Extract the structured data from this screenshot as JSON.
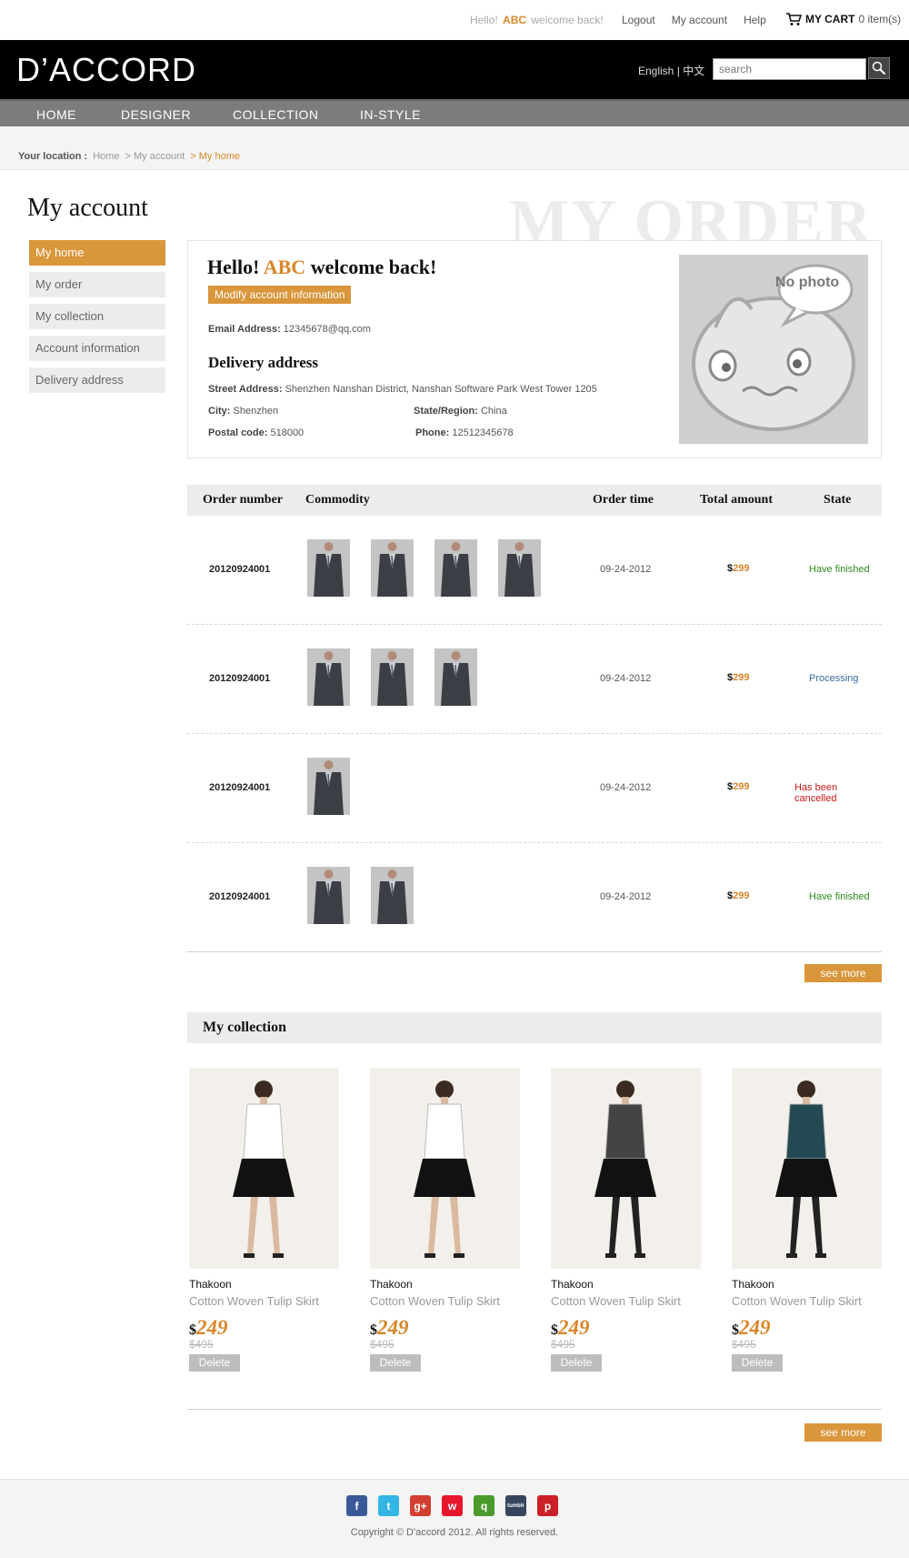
{
  "topbar": {
    "hello": "Hello!",
    "user": "ABC",
    "welcome": "welcome back!",
    "links": [
      "Logout",
      "My account",
      "Help"
    ],
    "cart_label": "MY CART",
    "cart_count": "0 item(s)"
  },
  "header": {
    "logo": "D’ACCORD",
    "lang_en": "English",
    "lang_sep": "|",
    "lang_zh": "中文",
    "search_placeholder": "search"
  },
  "nav": [
    "HOME",
    "DESIGNER",
    "COLLECTION",
    "IN-STYLE"
  ],
  "breadcrumb": {
    "label": "Your location :",
    "items": [
      "Home",
      "> My account",
      "> My home"
    ]
  },
  "sidebar": {
    "title": "My account",
    "items": [
      "My home",
      "My order",
      "My collection",
      "Account information",
      "Delivery address"
    ]
  },
  "watermark": "MY ORDER",
  "profile": {
    "hello": "Hello!",
    "user": "ABC",
    "welcome": "welcome back!",
    "modify_btn": "Modify account information",
    "email_label": "Email Address:",
    "email": "12345678@qq.com",
    "delivery_title": "Delivery address",
    "street_label": "Street Address:",
    "street": "Shenzhen Nanshan District, Nanshan Software Park West Tower 1205",
    "city_label": "City:",
    "city": "Shenzhen",
    "state_label": "State/Region:",
    "state": "China",
    "postal_label": "Postal code:",
    "postal": "518000",
    "phone_label": "Phone:",
    "phone": "12512345678",
    "photo_text": "No photo"
  },
  "orders": {
    "headers": [
      "Order number",
      "Commodity",
      "Order time",
      "Total amount",
      "State"
    ],
    "rows": [
      {
        "number": "20120924001",
        "thumbs": 4,
        "time": "09-24-2012",
        "currency": "$",
        "amount": "299",
        "state": "Have finished",
        "state_color": "#2e8b1e"
      },
      {
        "number": "20120924001",
        "thumbs": 3,
        "time": "09-24-2012",
        "currency": "$",
        "amount": "299",
        "state": "Processing",
        "state_color": "#3a6ea8"
      },
      {
        "number": "20120924001",
        "thumbs": 1,
        "time": "09-24-2012",
        "currency": "$",
        "amount": "299",
        "state": "Has been cancelled",
        "state_color": "#c81616"
      },
      {
        "number": "20120924001",
        "thumbs": 2,
        "time": "09-24-2012",
        "currency": "$",
        "amount": "299",
        "state": "Have finished",
        "state_color": "#2e8b1e"
      }
    ],
    "see_more": "see more"
  },
  "collection": {
    "title": "My collection",
    "items": [
      {
        "brand": "Thakoon",
        "name": "Cotton Woven Tulip Skirt",
        "currency": "$",
        "price": "249",
        "old_price": "$495",
        "delete": "Delete"
      },
      {
        "brand": "Thakoon",
        "name": "Cotton Woven Tulip Skirt",
        "currency": "$",
        "price": "249",
        "old_price": "$495",
        "delete": "Delete"
      },
      {
        "brand": "Thakoon",
        "name": "Cotton Woven Tulip Skirt",
        "currency": "$",
        "price": "249",
        "old_price": "$495",
        "delete": "Delete"
      },
      {
        "brand": "Thakoon",
        "name": "Cotton Woven Tulip Skirt",
        "currency": "$",
        "price": "249",
        "old_price": "$495",
        "delete": "Delete"
      }
    ],
    "see_more": "see more"
  },
  "footer": {
    "social": [
      {
        "name": "facebook-icon",
        "glyph": "f",
        "color": "#3b5998"
      },
      {
        "name": "twitter-icon",
        "glyph": "t",
        "color": "#33b5e5"
      },
      {
        "name": "google-plus-icon",
        "glyph": "g+",
        "color": "#d23f31"
      },
      {
        "name": "weibo-icon",
        "glyph": "w",
        "color": "#e6162d"
      },
      {
        "name": "qzone-icon",
        "glyph": "q",
        "color": "#4a9a2c"
      },
      {
        "name": "tumblr-icon",
        "glyph": "tumblr",
        "color": "#35465c"
      },
      {
        "name": "pinterest-icon",
        "glyph": "p",
        "color": "#cb2027"
      }
    ],
    "copyright": "Copyright © D'accord 2012. All rights reserved."
  },
  "colors": {
    "accent": "#d9963b",
    "accent_text": "#d9862a",
    "header_bg": "#000000",
    "nav_bg": "#7c7c7c"
  }
}
